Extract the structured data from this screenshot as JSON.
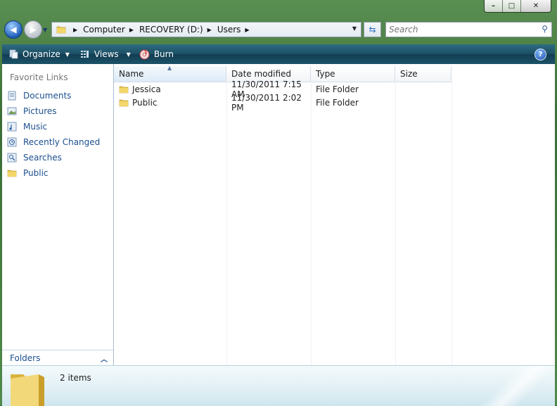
{
  "window": {
    "caption_buttons": [
      {
        "name": "minimize-button",
        "glyph": "–"
      },
      {
        "name": "maximize-button",
        "glyph": "□"
      },
      {
        "name": "close-button",
        "glyph": "✕"
      }
    ]
  },
  "address": {
    "crumbs": [
      "Computer",
      "RECOVERY (D:)",
      "Users"
    ],
    "search_placeholder": "Search"
  },
  "toolbar": {
    "organize_label": "Organize",
    "views_label": "Views",
    "burn_label": "Burn",
    "help_glyph": "?"
  },
  "nav_pane": {
    "title": "Favorite Links",
    "links": [
      {
        "label": "Documents",
        "icon": "documents-icon"
      },
      {
        "label": "Pictures",
        "icon": "pictures-icon"
      },
      {
        "label": "Music",
        "icon": "music-icon"
      },
      {
        "label": "Recently Changed",
        "icon": "recently-changed-icon"
      },
      {
        "label": "Searches",
        "icon": "searches-icon"
      },
      {
        "label": "Public",
        "icon": "folder-icon"
      }
    ],
    "folders_label": "Folders"
  },
  "file_list": {
    "columns": [
      "Name",
      "Date modified",
      "Type",
      "Size"
    ],
    "rows": [
      {
        "name": "Jessica",
        "date": "11/30/2011 7:15 AM",
        "type": "File Folder",
        "size": ""
      },
      {
        "name": "Public",
        "date": "11/30/2011 2:02 PM",
        "type": "File Folder",
        "size": ""
      }
    ]
  },
  "details": {
    "item_count": "2 items"
  },
  "colors": {
    "link_blue": "#1c4f8f",
    "toolbar_dark": "#1c5066",
    "frame_green": "#4f8a4a"
  }
}
